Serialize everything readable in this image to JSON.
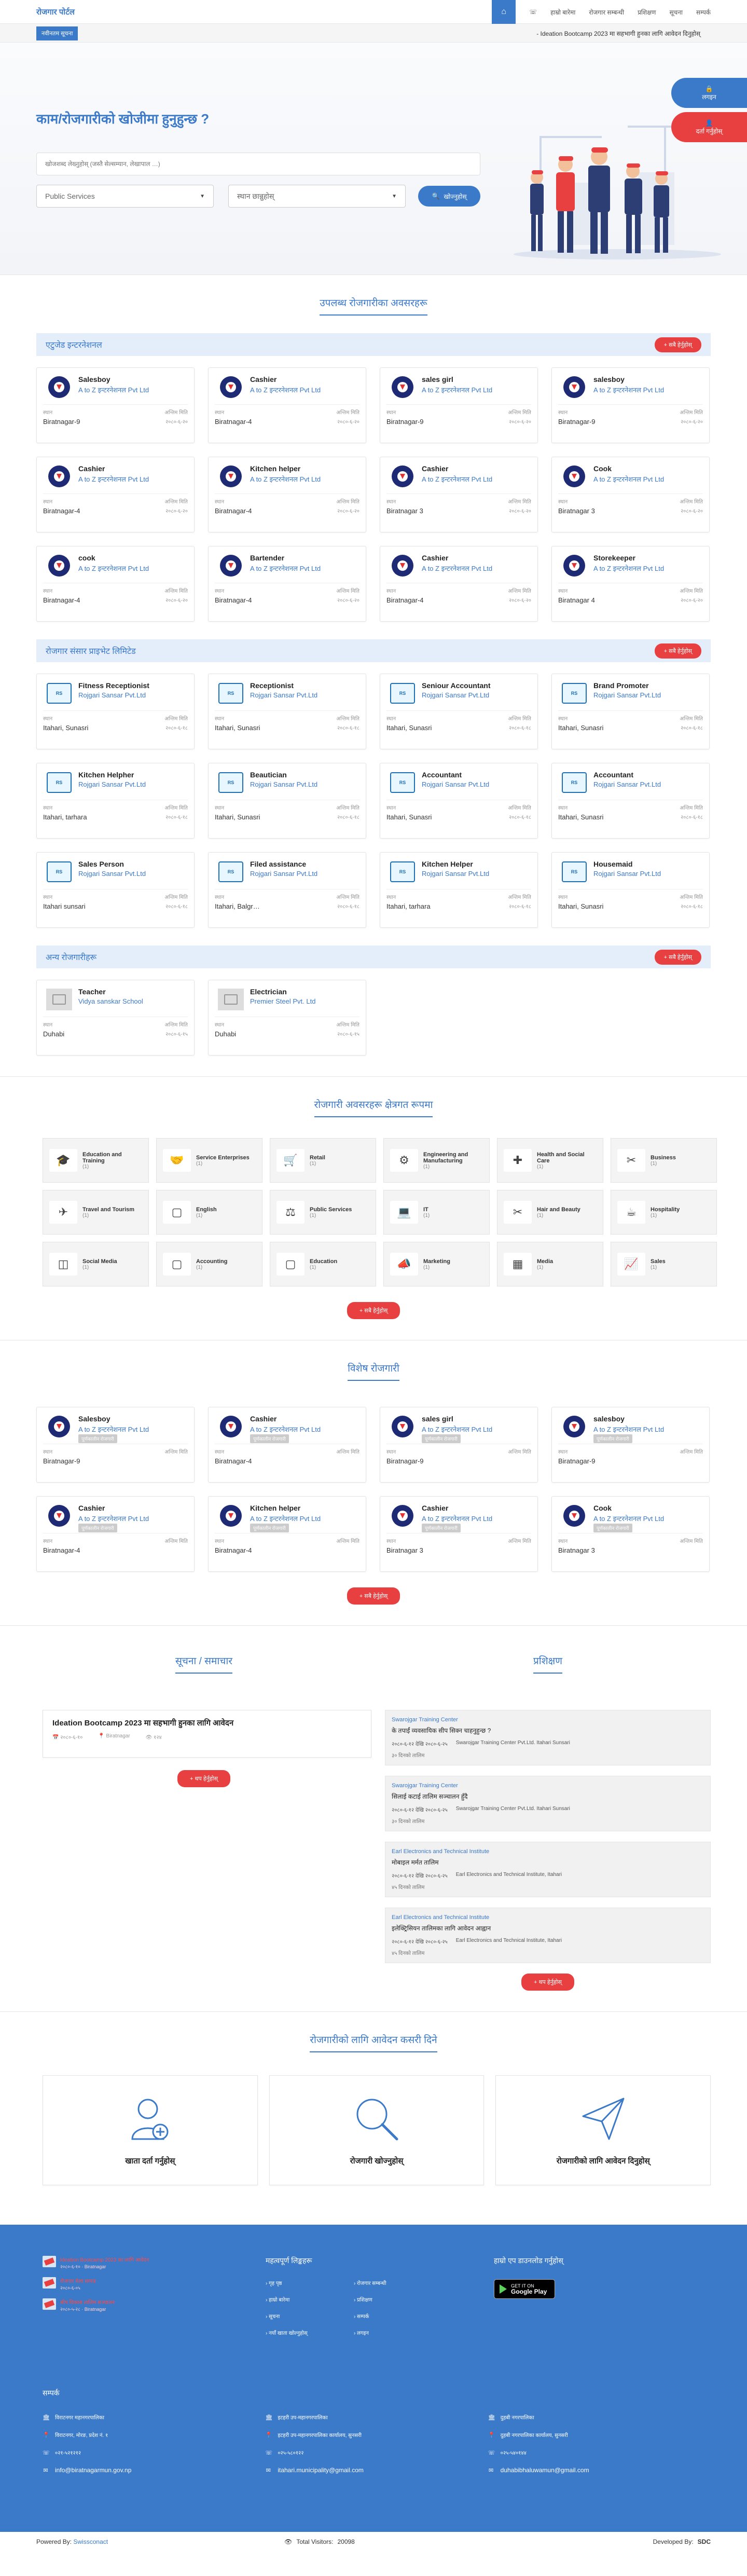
{
  "brand": "रोजगार पोर्टल",
  "nav": {
    "items": [
      "हाम्रो बारेमा",
      "रोजगार सम्बन्धी",
      "प्रशिक्षण",
      "सूचना",
      "सम्पर्क"
    ]
  },
  "ticker": {
    "tag": "नवीनतम सूचना",
    "text": "- Ideation Bootcamp 2023 मा सहभागी हुनका लागि आवेदन दिनुहोस्"
  },
  "floating": {
    "login": "लगइन",
    "register": "दर्ता गर्नुहोस्"
  },
  "hero": {
    "title": "काम/रोजगारीको खोजीमा हुनुहुन्छ ?",
    "search_placeholder": "खोजशब्द लेख्नुहोस् (जस्तै सेल्सम्यान, लेखापाल …)",
    "category": "Public Services",
    "location_placeholder": "स्थान छान्नुहोस्",
    "search_button": "खोज्नुहोस्"
  },
  "sections": {
    "vacancies_title": "उपलब्ध रोजगारीका अवसरहरू",
    "categories_title": "रोजगारी अवसरहरू क्षेत्रगत रूपमा",
    "featured_title": "विशेष रोजगारी",
    "news_title": "सूचना / समाचार",
    "training_title": "प्रशिक्षण",
    "steps_title": "रोजगारीको लागि आवेदन कसरी दिने"
  },
  "buttons": {
    "view_all": "+ सबै हेर्नुहोस्",
    "view_more": "+ थप हेर्नुहोस्"
  },
  "groups": [
    {
      "name": "एटुजेड इन्टरनेशनल",
      "logo": "atoz",
      "jobs": [
        {
          "title": "Salesboy",
          "org": "A to Z इन्टरनेशनल Pvt Ltd",
          "loc": "Biratnagar-9",
          "date": "२०८०-६-२०"
        },
        {
          "title": "Cashier",
          "org": "A to Z इन्टरनेशनल Pvt Ltd",
          "loc": "Biratnagar-4",
          "date": "२०८०-६-२०"
        },
        {
          "title": "sales girl",
          "org": "A to Z इन्टरनेशनल Pvt Ltd",
          "loc": "Biratnagar-9",
          "date": "२०८०-६-२०"
        },
        {
          "title": "salesboy",
          "org": "A to Z इन्टरनेशनल Pvt Ltd",
          "loc": "Biratnagar-9",
          "date": "२०८०-६-२०"
        },
        {
          "title": "Cashier",
          "org": "A to Z इन्टरनेशनल Pvt Ltd",
          "loc": "Biratnagar-4",
          "date": "२०८०-६-२०"
        },
        {
          "title": "Kitchen helper",
          "org": "A to Z इन्टरनेशनल Pvt Ltd",
          "loc": "Biratnagar-4",
          "date": "२०८०-६-२०"
        },
        {
          "title": "Cashier",
          "org": "A to Z इन्टरनेशनल Pvt Ltd",
          "loc": "Biratnagar 3",
          "date": "२०८०-६-२०"
        },
        {
          "title": "Cook",
          "org": "A to Z इन्टरनेशनल Pvt Ltd",
          "loc": "Biratnagar 3",
          "date": "२०८०-६-२०"
        },
        {
          "title": "cook",
          "org": "A to Z इन्टरनेशनल Pvt Ltd",
          "loc": "Biratnagar-4",
          "date": "२०८०-६-२०"
        },
        {
          "title": "Bartender",
          "org": "A to Z इन्टरनेशनल Pvt Ltd",
          "loc": "Biratnagar-4",
          "date": "२०८०-६-२०"
        },
        {
          "title": "Cashier",
          "org": "A to Z इन्टरनेशनल Pvt Ltd",
          "loc": "Biratnagar-4",
          "date": "२०८०-६-२०"
        },
        {
          "title": "Storekeeper",
          "org": "A to Z इन्टरनेशनल Pvt Ltd",
          "loc": "Biratnagar 4",
          "date": "२०८०-६-२०"
        }
      ]
    },
    {
      "name": "रोजगार संसार प्राइभेट लिमिटेड",
      "logo": "rs",
      "jobs": [
        {
          "title": "Fitness Receptionist",
          "org": "Rojgari Sansar Pvt.Ltd",
          "loc": "Itahari, Sunasri",
          "date": "२०८०-६-१८"
        },
        {
          "title": "Receptionist",
          "org": "Rojgari Sansar Pvt.Ltd",
          "loc": "Itahari, Sunasri",
          "date": "२०८०-६-१८"
        },
        {
          "title": "Seniour Accountant",
          "org": "Rojgari Sansar Pvt.Ltd",
          "loc": "Itahari, Sunasri",
          "date": "२०८०-६-१८"
        },
        {
          "title": "Brand Promoter",
          "org": "Rojgari Sansar Pvt.Ltd",
          "loc": "Itahari, Sunasri",
          "date": "२०८०-६-१८"
        },
        {
          "title": "Kitchen Helpher",
          "org": "Rojgari Sansar Pvt.Ltd",
          "loc": "Itahari, tarhara",
          "date": "२०८०-६-१८"
        },
        {
          "title": "Beautician",
          "org": "Rojgari Sansar Pvt.Ltd",
          "loc": "Itahari, Sunasri",
          "date": "२०८०-६-१८"
        },
        {
          "title": "Accountant",
          "org": "Rojgari Sansar Pvt.Ltd",
          "loc": "Itahari, Sunasri",
          "date": "२०८०-६-१८"
        },
        {
          "title": "Accountant",
          "org": "Rojgari Sansar Pvt.Ltd",
          "loc": "Itahari, Sunasri",
          "date": "२०८०-६-१८"
        },
        {
          "title": "Sales Person",
          "org": "Rojgari Sansar Pvt.Ltd",
          "loc": "Itahari sunsari",
          "date": "२०८०-६-१८"
        },
        {
          "title": "Filed assistance",
          "org": "Rojgari Sansar Pvt.Ltd",
          "loc": "Itahari, Balgr…",
          "date": "२०८०-६-१८"
        },
        {
          "title": "Kitchen Helper",
          "org": "Rojgari Sansar Pvt.Ltd",
          "loc": "Itahari, tarhara",
          "date": "२०८०-६-१८"
        },
        {
          "title": "Housemaid",
          "org": "Rojgari Sansar Pvt.Ltd",
          "loc": "Itahari, Sunasri",
          "date": "२०८०-६-१८"
        }
      ]
    },
    {
      "name": "अन्य रोजगारीहरू",
      "logo": "ph",
      "jobs": [
        {
          "title": "Teacher",
          "org": "Vidya sanskar School",
          "loc": "Duhabi",
          "date": "२०८०-६-१५"
        },
        {
          "title": "Electrician",
          "org": "Premier Steel Pvt. Ltd",
          "loc": "Duhabi",
          "date": "२०८०-६-१५"
        }
      ]
    }
  ],
  "card_labels": {
    "location": "स्थान",
    "deadline": "अन्तिम मिति"
  },
  "categories": [
    {
      "label": "Education and Training",
      "count": "(1)",
      "icon": "🎓"
    },
    {
      "label": "Service Enterprises",
      "count": "(1)",
      "icon": "🤝"
    },
    {
      "label": "Retail",
      "count": "(1)",
      "icon": "🛒"
    },
    {
      "label": "Engineering and Manufacturing",
      "count": "(1)",
      "icon": "⚙"
    },
    {
      "label": "Health and Social Care",
      "count": "(1)",
      "icon": "✚"
    },
    {
      "label": "Business",
      "count": "(1)",
      "icon": "✂"
    },
    {
      "label": "Travel and Tourism",
      "count": "(1)",
      "icon": "✈"
    },
    {
      "label": "English",
      "count": "(1)",
      "icon": "▢"
    },
    {
      "label": "Public Services",
      "count": "(1)",
      "icon": "⚖"
    },
    {
      "label": "IT",
      "count": "(1)",
      "icon": "💻"
    },
    {
      "label": "Hair and Beauty",
      "count": "(1)",
      "icon": "✂"
    },
    {
      "label": "Hospitality",
      "count": "(1)",
      "icon": "☕"
    },
    {
      "label": "Social Media",
      "count": "(1)",
      "icon": "◫"
    },
    {
      "label": "Accounting",
      "count": "(1)",
      "icon": "▢"
    },
    {
      "label": "Education",
      "count": "(1)",
      "icon": "▢"
    },
    {
      "label": "Marketing",
      "count": "(1)",
      "icon": "📣"
    },
    {
      "label": "Media",
      "count": "(1)",
      "icon": "▦"
    },
    {
      "label": "Sales",
      "count": "(1)",
      "icon": "📈"
    }
  ],
  "featured": [
    {
      "title": "Salesboy",
      "org": "A to Z इन्टरनेशनल Pvt Ltd",
      "loc": "Biratnagar-9"
    },
    {
      "title": "Cashier",
      "org": "A to Z इन्टरनेशनल Pvt Ltd",
      "loc": "Biratnagar-4"
    },
    {
      "title": "sales girl",
      "org": "A to Z इन्टरनेशनल Pvt Ltd",
      "loc": "Biratnagar-9"
    },
    {
      "title": "salesboy",
      "org": "A to Z इन्टरनेशनल Pvt Ltd",
      "loc": "Biratnagar-9"
    },
    {
      "title": "Cashier",
      "org": "A to Z इन्टरनेशनल Pvt Ltd",
      "loc": "Biratnagar-4"
    },
    {
      "title": "Kitchen helper",
      "org": "A to Z इन्टरनेशनल Pvt Ltd",
      "loc": "Biratnagar-4"
    },
    {
      "title": "Cashier",
      "org": "A to Z इन्टरनेशनल Pvt Ltd",
      "loc": "Biratnagar 3"
    },
    {
      "title": "Cook",
      "org": "A to Z इन्टरनेशनल Pvt Ltd",
      "loc": "Biratnagar 3"
    }
  ],
  "featured_badge": "पूर्णकालीन रोजगारी",
  "news": {
    "title": "Ideation Bootcamp 2023 मा सहभागी हुनका लागि आवेदन",
    "date": "२०८०-६-१०",
    "loc": "Biratnagar",
    "views": "१२४"
  },
  "trainings": [
    {
      "inst": "Swarojgar Training Center",
      "q": "के तपाईं व्यवसायिक सीप सिक्न चाहनुहुन्छ ?",
      "date": "२०८०-६-१२ देखि २०८०-६-२५",
      "place": "Swarojgar Training Center Pvt.Ltd. Itahari Sunsari",
      "extra": "३० दिनको तालिम"
    },
    {
      "inst": "Swarojgar Training Center",
      "q": "सिलाई कटाई तालिम सञ्चालन हुँदै",
      "date": "२०८०-६-१२ देखि २०८०-६-२५",
      "place": "Swarojgar Training Center Pvt.Ltd. Itahari Sunsari",
      "extra": "३० दिनको तालिम"
    },
    {
      "inst": "Earl Electronics and Technical Institute",
      "q": "मोबाइल मर्मत तालिम",
      "date": "२०८०-६-१२ देखि २०८०-६-२५",
      "place": "Earl Electronics and Technical Institute, Itahari",
      "extra": "४५ दिनको तालिम"
    },
    {
      "inst": "Earl Electronics and Technical Institute",
      "q": "इलेक्ट्रिसियन तालिमका लागि आवेदन आह्वान",
      "date": "२०८०-६-१२ देखि २०८०-६-२५",
      "place": "Earl Electronics and Technical Institute, Itahari",
      "extra": "४५ दिनको तालिम"
    }
  ],
  "steps": [
    {
      "label": "खाता दर्ता गर्नुहोस्",
      "icon": "user-plus-icon"
    },
    {
      "label": "रोजगारी खोज्नुहोस्",
      "icon": "search-icon"
    },
    {
      "label": "रोजगारीको लागि आवेदन दिनुहोस्",
      "icon": "send-icon"
    }
  ],
  "footer": {
    "news": [
      {
        "t": "Ideation Bootcamp 2023 का लागि आवेदन",
        "s": "२०८०-६-१० · Biratnagar"
      },
      {
        "t": "रोजगार मेला सम्पन्न",
        "s": "२०८०-६-०५"
      },
      {
        "t": "सीप विकास तालिम सञ्चालन",
        "s": "२०८०-५-२८ · Biratnagar"
      }
    ],
    "links_title": "महत्वपूर्ण लिङ्कहरू",
    "links": [
      "गृह पृष्ठ",
      "रोजगार सम्बन्धी",
      "हाम्रो बारेमा",
      "प्रशिक्षण",
      "सूचना",
      "सम्पर्क",
      "नयाँ खाता खोल्नुहोस्",
      "लगइन"
    ],
    "app_title": "हाम्रो एप डाउनलोड गर्नुहोस्",
    "gplay_small": "GET IT ON",
    "gplay_big": "Google Play",
    "contact_title": "सम्पर्क",
    "contacts": [
      [
        "विराटनगर महानगरपालिका",
        "विराटनगर, मोरङ, प्रदेश नं. १",
        "०२१-५२१२१२",
        "info@biratnagarmun.gov.np"
      ],
      [
        "इटहरी उप-महानगरपालिका",
        "इटहरी उप-महानगरपालिका कार्यालय, सुनसरी",
        "०२५-५८०१२२",
        "itahari.municipality@gmail.com"
      ],
      [
        "दुहबी नगरपालिका",
        "दुहबी नगरपालिका कार्यालय, सुनसरी",
        "०२५-५४०१४४",
        "duhabibhaluwamun@gmail.com"
      ]
    ]
  },
  "bottom": {
    "powered": "Powered By:",
    "powered_link": "Swissconact",
    "visitors_label": "Total Visitors:",
    "visitors": "20098",
    "developed": "Developed By:",
    "dev_logo": "SDC"
  },
  "colors": {
    "primary": "#3b79c9",
    "danger": "#e84040"
  }
}
